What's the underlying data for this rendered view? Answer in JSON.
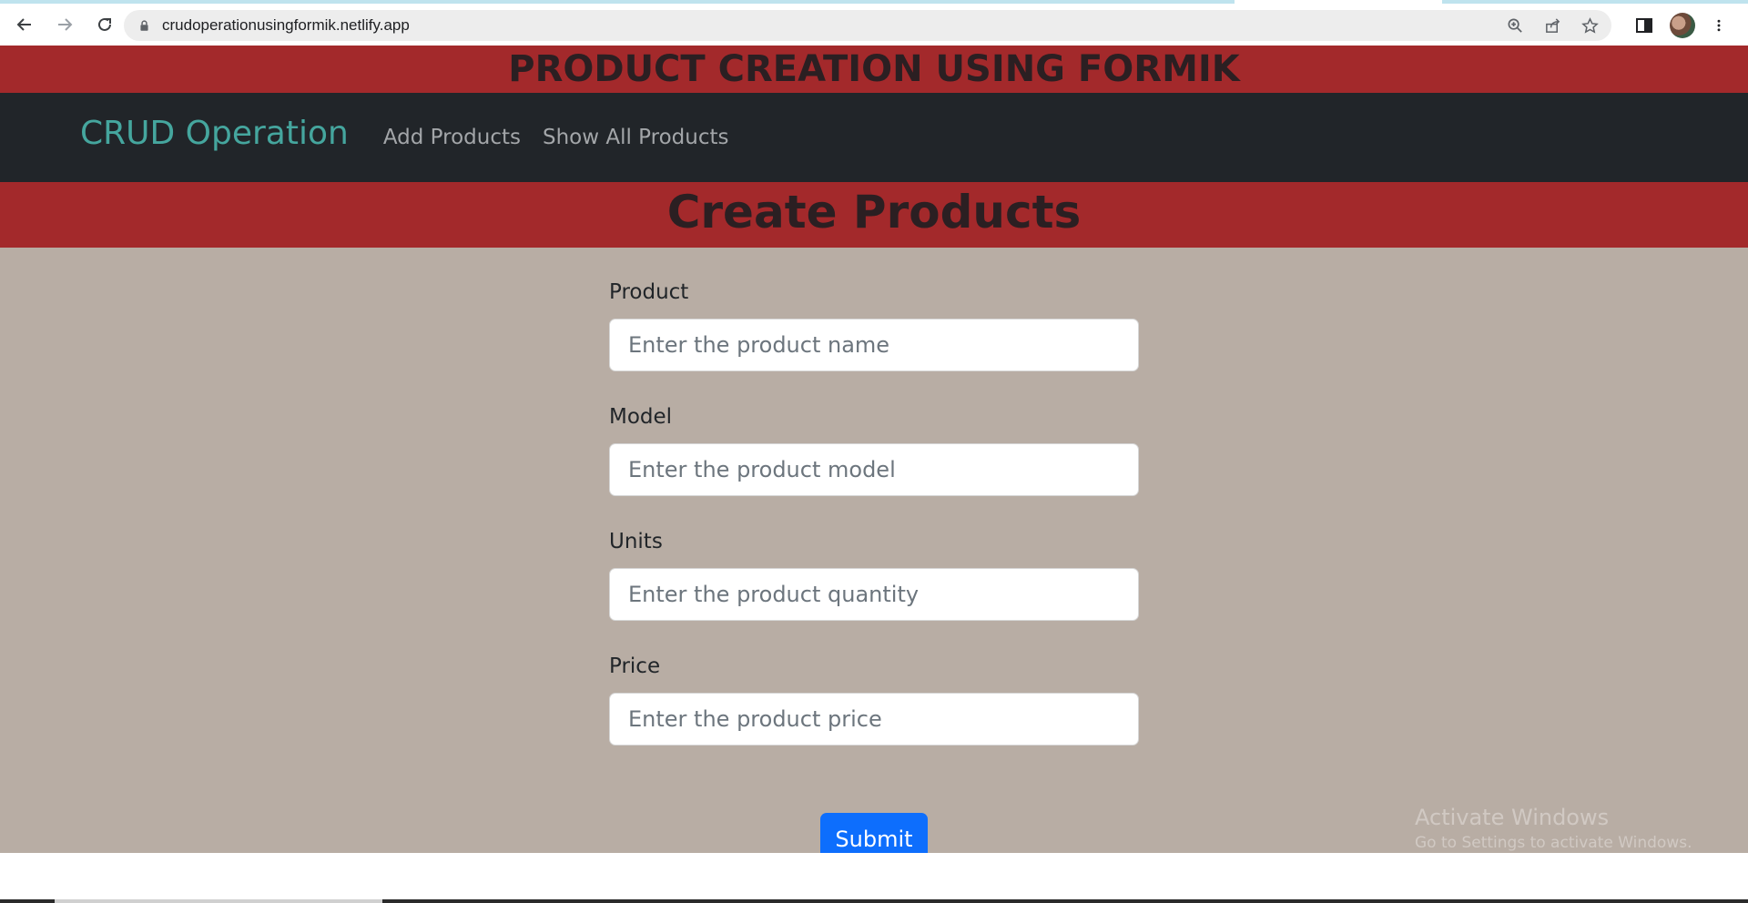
{
  "browser": {
    "url": "crudoperationusingformik.netlify.app",
    "icons": [
      "back-icon",
      "forward-icon",
      "reload-icon",
      "lock-icon",
      "zoom-icon",
      "share-icon",
      "bookmark-star-icon",
      "side-panel-icon",
      "avatar",
      "kebab-menu-icon"
    ]
  },
  "app": {
    "title": "PRODUCT CREATION USING FORMIK",
    "brand": "CRUD Operation",
    "nav": [
      "Add Products",
      "Show All Products"
    ],
    "section_title": "Create Products"
  },
  "form": {
    "fields": [
      {
        "label": "Product",
        "placeholder": "Enter the product name",
        "value": ""
      },
      {
        "label": "Model",
        "placeholder": "Enter the product model",
        "value": ""
      },
      {
        "label": "Units",
        "placeholder": "Enter the product quantity",
        "value": ""
      },
      {
        "label": "Price",
        "placeholder": "Enter the product price",
        "value": ""
      }
    ],
    "submit_label": "Submit"
  },
  "watermark": {
    "line1": "Activate Windows",
    "line2": "Go to Settings to activate Windows."
  },
  "colors": {
    "banner": "#a3292b",
    "navbar": "#212529",
    "brand": "#45a69e",
    "page_bg": "#b8ada4",
    "button": "#0d6efd"
  }
}
